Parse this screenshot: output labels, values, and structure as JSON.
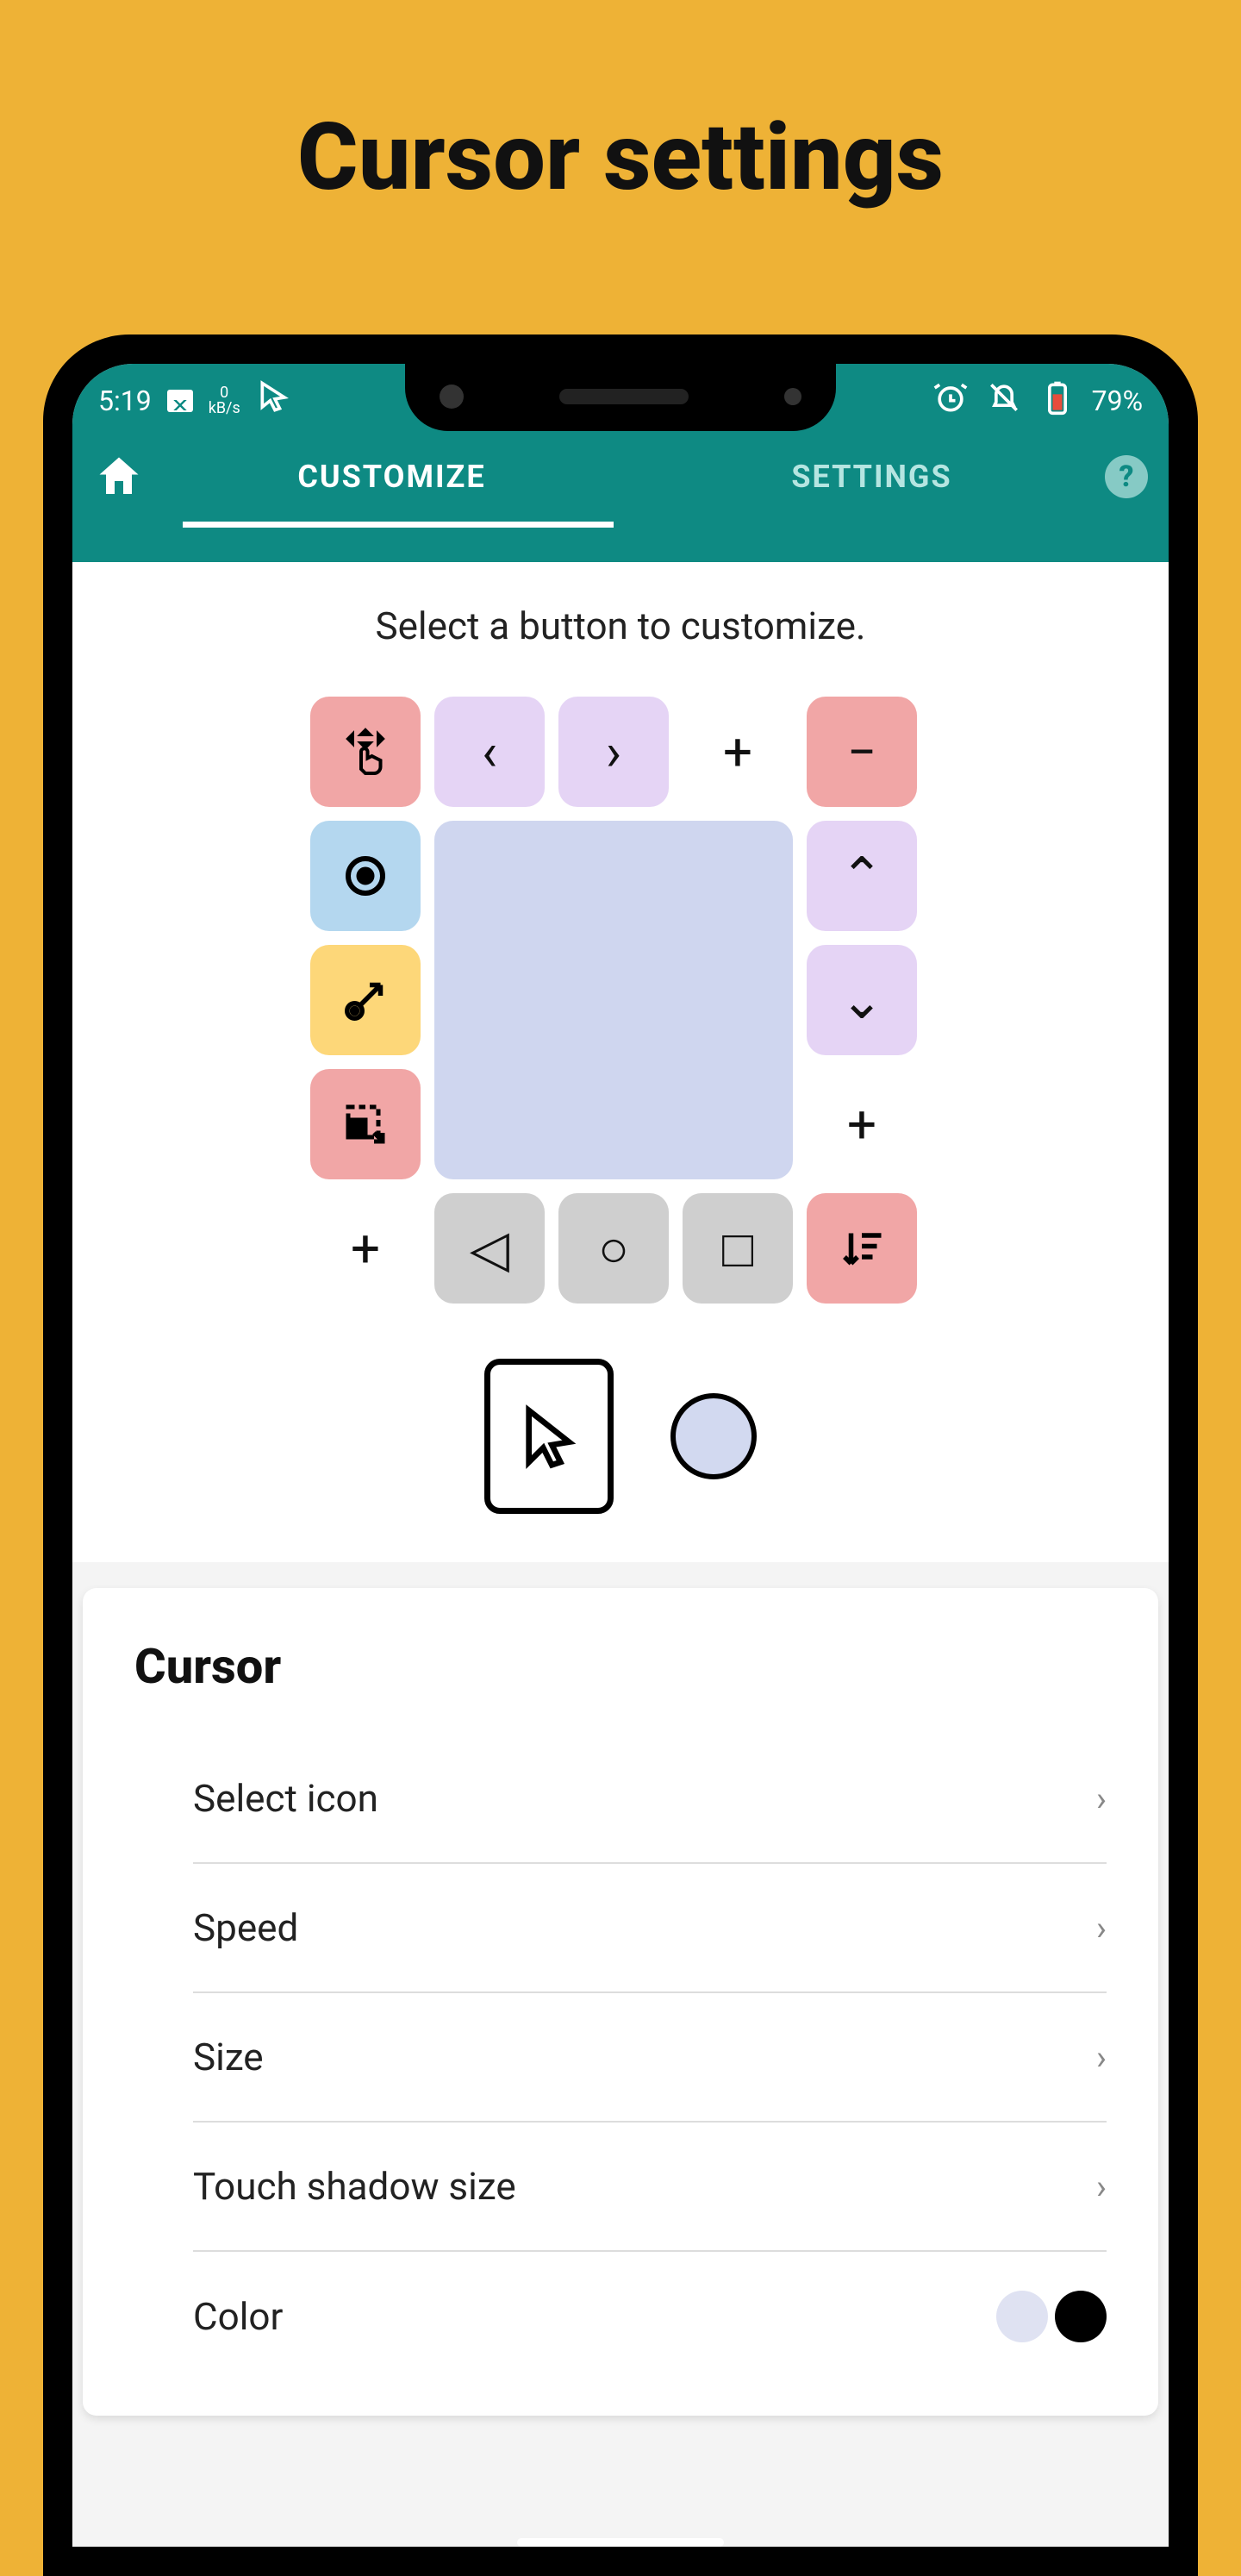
{
  "page": {
    "heading": "Cursor settings"
  },
  "status": {
    "time": "5:19",
    "kbs_top": "0",
    "kbs_bottom": "kB/s",
    "battery": "79%"
  },
  "tabs": {
    "customize": "CUSTOMIZE",
    "settings": "SETTINGS"
  },
  "instruction": "Select a button to customize.",
  "card": {
    "title": "Cursor",
    "items": {
      "select_icon": "Select icon",
      "speed": "Speed",
      "size": "Size",
      "touch_shadow": "Touch shadow size",
      "color": "Color"
    }
  },
  "icons": {
    "home": "home-icon",
    "help": "?",
    "alarm": "alarm-icon",
    "nodist": "do-not-disturb-icon",
    "battery": "battery-icon",
    "cursor_small": "cursor-icon"
  },
  "glyphs": {
    "left": "‹",
    "right": "›",
    "plus": "+",
    "minus": "−",
    "up": "⌃",
    "down": "⌄",
    "tri_left": "◁",
    "circle": "○",
    "square": "□"
  }
}
